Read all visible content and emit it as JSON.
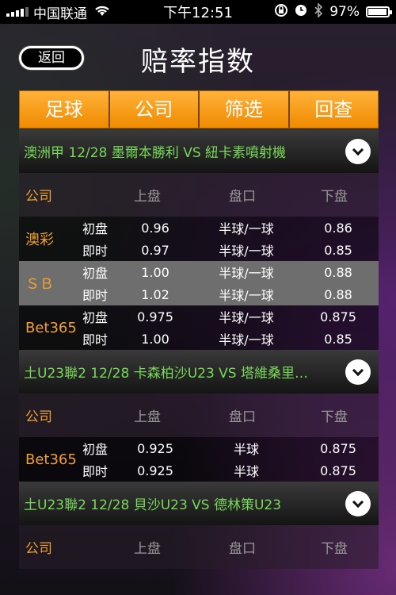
{
  "status_bar": {
    "carrier": "中国联通",
    "time": "下午12:51",
    "battery": "97%",
    "battery_level": 0.97
  },
  "nav": {
    "back_label": "返回",
    "title": "赔率指数"
  },
  "tabs": [
    "足球",
    "公司",
    "筛选",
    "回查"
  ],
  "columns": {
    "company": "公司",
    "up": "上盘",
    "pan": "盘口",
    "down": "下盘"
  },
  "matches": [
    {
      "title": "澳洲甲  12/28  墨爾本勝利 VS 紐卡素噴射機",
      "bookmakers": [
        {
          "name": "澳彩",
          "shade": "dark",
          "lines": [
            {
              "label": "初盘",
              "up": "0.96",
              "pan": "半球/一球",
              "down": "0.86"
            },
            {
              "label": "即时",
              "up": "0.97",
              "pan": "半球/一球",
              "down": "0.85"
            }
          ]
        },
        {
          "name": "ＳＢ",
          "shade": "light",
          "lines": [
            {
              "label": "初盘",
              "up": "1.00",
              "pan": "半球/一球",
              "down": "0.88"
            },
            {
              "label": "即时",
              "up": "1.02",
              "pan": "半球/一球",
              "down": "0.88"
            }
          ]
        },
        {
          "name": "Bet365",
          "shade": "dark",
          "lines": [
            {
              "label": "初盘",
              "up": "0.975",
              "pan": "半球/一球",
              "down": "0.875"
            },
            {
              "label": "即时",
              "up": "1.00",
              "pan": "半球/一球",
              "down": "0.85"
            }
          ]
        }
      ]
    },
    {
      "title": "土U23聯2  12/28  卡森柏沙U23 VS 塔維桑里…",
      "bookmakers": [
        {
          "name": "Bet365",
          "shade": "dark",
          "lines": [
            {
              "label": "初盘",
              "up": "0.925",
              "pan": "半球",
              "down": "0.875"
            },
            {
              "label": "即时",
              "up": "0.925",
              "pan": "半球",
              "down": "0.875"
            }
          ]
        }
      ]
    },
    {
      "title": "土U23聯2  12/28  貝沙U23 VS 德林策U23",
      "bookmakers": []
    }
  ],
  "icons": {
    "chevron": "chevron-down-icon",
    "wifi": "wifi-icon",
    "lock_rotation": "rotation-lock-icon",
    "alarm": "alarm-icon",
    "bluetooth": "bluetooth-icon",
    "battery": "battery-icon"
  },
  "colors": {
    "tab_orange": "#f39a10",
    "match_title_green": "#78d85a",
    "company_orange": "#f0a030"
  }
}
